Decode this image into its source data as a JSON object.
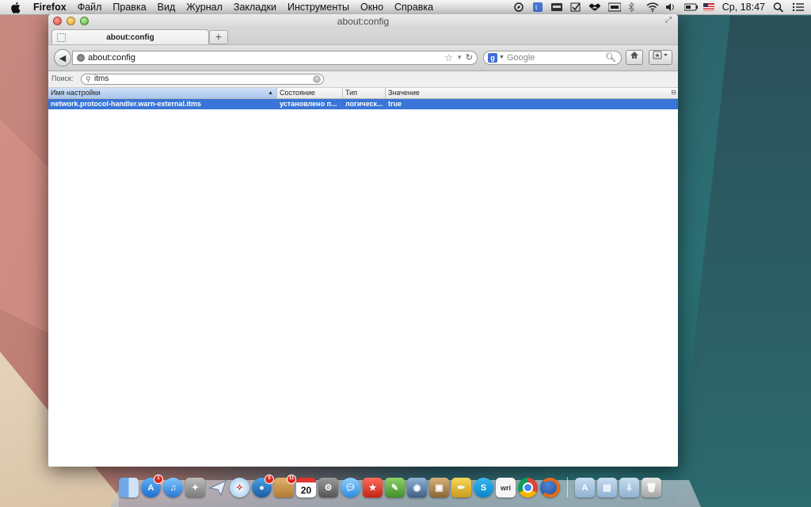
{
  "menubar": {
    "app": "Firefox",
    "items": [
      "Файл",
      "Правка",
      "Вид",
      "Журнал",
      "Закладки",
      "Инструменты",
      "Окно",
      "Справка"
    ],
    "clock": "Ср, 18:47"
  },
  "window": {
    "title": "about:config",
    "tab_title": "about:config",
    "new_tab_symbol": "+",
    "url": "about:config",
    "search_placeholder": "Google",
    "search_engine_icon": "g"
  },
  "filter": {
    "label": "Поиск:",
    "value": "itms"
  },
  "table": {
    "columns": [
      "Имя настройки",
      "Состояние",
      "Тип",
      "Значение"
    ],
    "rows": [
      {
        "name": "network.protocol-handler.warn-external.itms",
        "status": "установлено п...",
        "type": "логическ...",
        "value": "true"
      }
    ]
  },
  "dock": {
    "badges": {
      "app_store": "1",
      "tweetbot": "6",
      "package": "11"
    },
    "calendar_day": "20",
    "skype_letter": "S",
    "writer_label": "wri"
  },
  "colors": {
    "selection": "#3875d7",
    "sort_header": "#a9c7ee"
  }
}
